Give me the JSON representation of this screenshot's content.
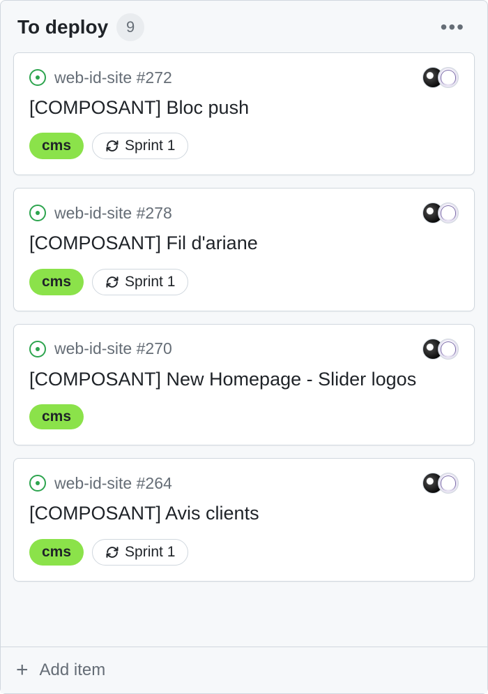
{
  "column": {
    "title": "To deploy",
    "count": "9",
    "addItemLabel": "Add item"
  },
  "labels": {
    "cms": "cms",
    "sprint": "Sprint 1"
  },
  "cards": [
    {
      "repo": "web-id-site",
      "number": "#272",
      "title": "[COMPOSANT] Bloc push",
      "showSprint": true
    },
    {
      "repo": "web-id-site",
      "number": "#278",
      "title": "[COMPOSANT] Fil d'ariane",
      "showSprint": true
    },
    {
      "repo": "web-id-site",
      "number": "#270",
      "title": "[COMPOSANT] New Homepage - Slider logos",
      "showSprint": false
    },
    {
      "repo": "web-id-site",
      "number": "#264",
      "title": "[COMPOSANT] Avis clients",
      "showSprint": true
    }
  ]
}
